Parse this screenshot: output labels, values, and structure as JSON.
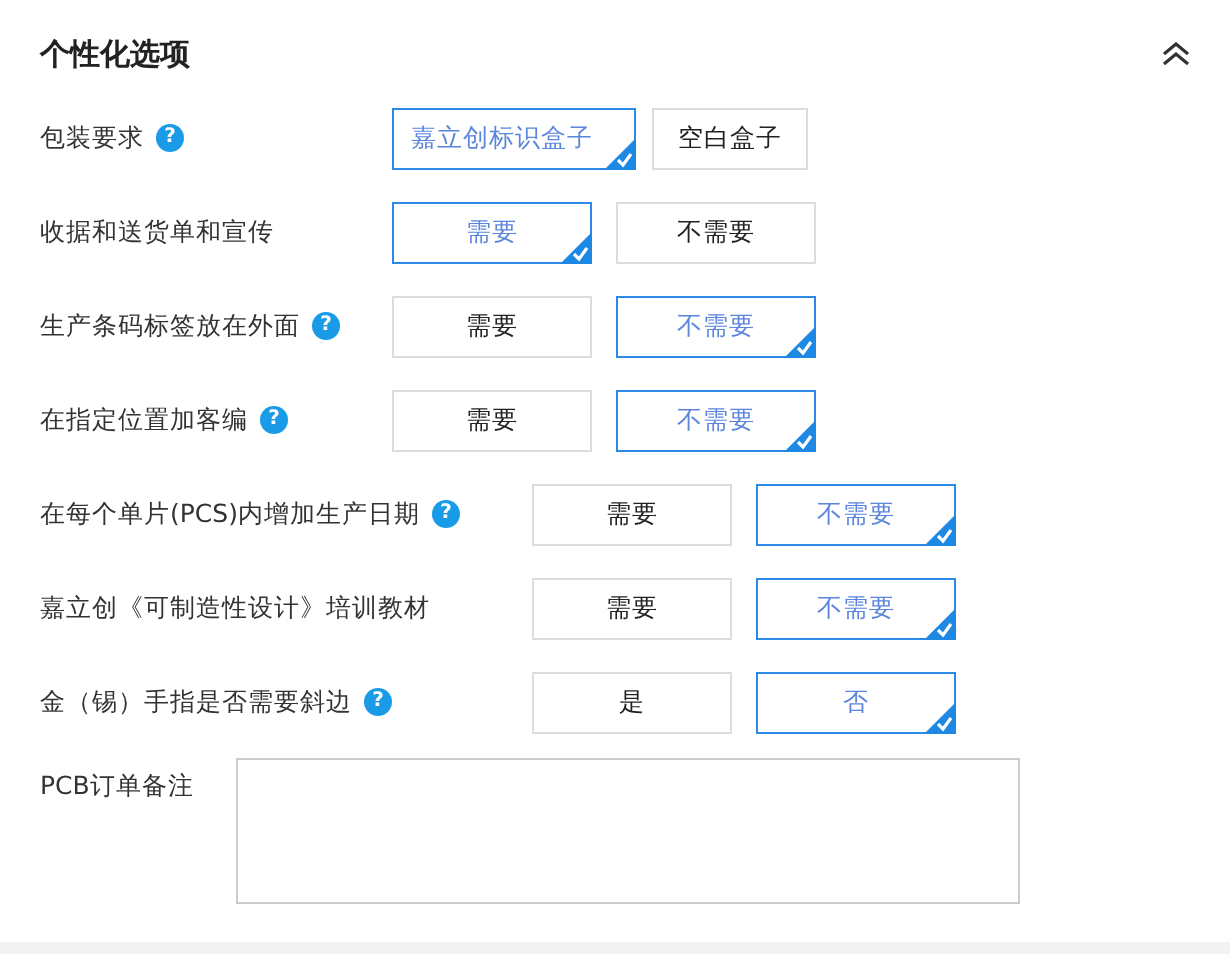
{
  "section": {
    "title": "个性化选项",
    "expanded": true
  },
  "rows": [
    {
      "label": "包装要求",
      "help": "?",
      "options": [
        {
          "label": "嘉立创标识盒子",
          "selected": true
        },
        {
          "label": "空白盒子",
          "selected": false
        }
      ]
    },
    {
      "label": "收据和送货单和宣传",
      "options": [
        {
          "label": "需要",
          "selected": true
        },
        {
          "label": "不需要",
          "selected": false
        }
      ]
    },
    {
      "label": "生产条码标签放在外面",
      "help": "?",
      "options": [
        {
          "label": "需要",
          "selected": false
        },
        {
          "label": "不需要",
          "selected": true
        }
      ]
    },
    {
      "label": "在指定位置加客编",
      "help": "?",
      "options": [
        {
          "label": "需要",
          "selected": false
        },
        {
          "label": "不需要",
          "selected": true
        }
      ]
    },
    {
      "label": "在每个单片(PCS)内增加生产日期",
      "help": "?",
      "options": [
        {
          "label": "需要",
          "selected": false
        },
        {
          "label": "不需要",
          "selected": true
        }
      ]
    },
    {
      "label": "嘉立创《可制造性设计》培训教材",
      "options": [
        {
          "label": "需要",
          "selected": false
        },
        {
          "label": "不需要",
          "selected": true
        }
      ]
    },
    {
      "label": "金（锡）手指是否需要斜边",
      "help": "?",
      "options": [
        {
          "label": "是",
          "selected": false
        },
        {
          "label": "否",
          "selected": true
        }
      ]
    }
  ],
  "remark": {
    "label": "PCB订单备注"
  }
}
